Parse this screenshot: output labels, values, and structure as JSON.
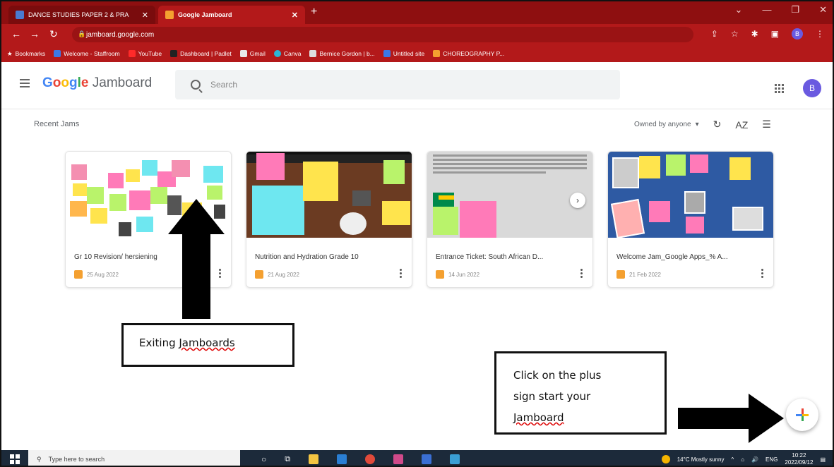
{
  "browser": {
    "tabs": [
      {
        "label": "DANCE STUDIES PAPER 2 & PRA",
        "active": false
      },
      {
        "label": "Google Jamboard",
        "active": true
      }
    ],
    "new_tab": "+",
    "url": "jamboard.google.com",
    "bookmarks": [
      "Bookmarks",
      "Welcome - Staffroom",
      "YouTube",
      "Dashboard | Padlet",
      "Gmail",
      "Canva",
      "Bernice Gordon | b...",
      "Untitled site",
      "CHOREOGRAPHY P..."
    ],
    "profile_initial": "B"
  },
  "app": {
    "brand_google": "Google",
    "brand_product": "Jamboard",
    "search_placeholder": "Search",
    "avatar_initial": "B",
    "section_title": "Recent Jams",
    "owned_filter": "Owned by anyone",
    "refresh_label": "C",
    "sort_label": "AZ"
  },
  "jams": [
    {
      "title": "Gr 10 Revision/ hersiening",
      "date": "25 Aug 2022",
      "theme": "white"
    },
    {
      "title": "Nutrition and Hydration Grade 10",
      "date": "21 Aug 2022",
      "theme": "wood"
    },
    {
      "title": "Entrance Ticket: South African D...",
      "date": "14 Jun 2022",
      "theme": "grey"
    },
    {
      "title": "Welcome Jam_Google Apps_% A...",
      "date": "21 Feb 2022",
      "theme": "blue"
    }
  ],
  "annotations": {
    "existing": "Exiting Jamboards",
    "plus_line1": "Click on the plus",
    "plus_line2": "sign start your",
    "plus_line3": "Jamboard"
  },
  "taskbar": {
    "search_placeholder": "Type here to search",
    "weather": "14°C  Mostly sunny",
    "lang": "ENG",
    "time": "10:22",
    "date": "2022/09/12"
  },
  "colors": {
    "chrome_dark": "#8e0f10",
    "chrome": "#b3191a",
    "jam_icon": "#f4a030",
    "avatar": "#6a5ae0"
  }
}
